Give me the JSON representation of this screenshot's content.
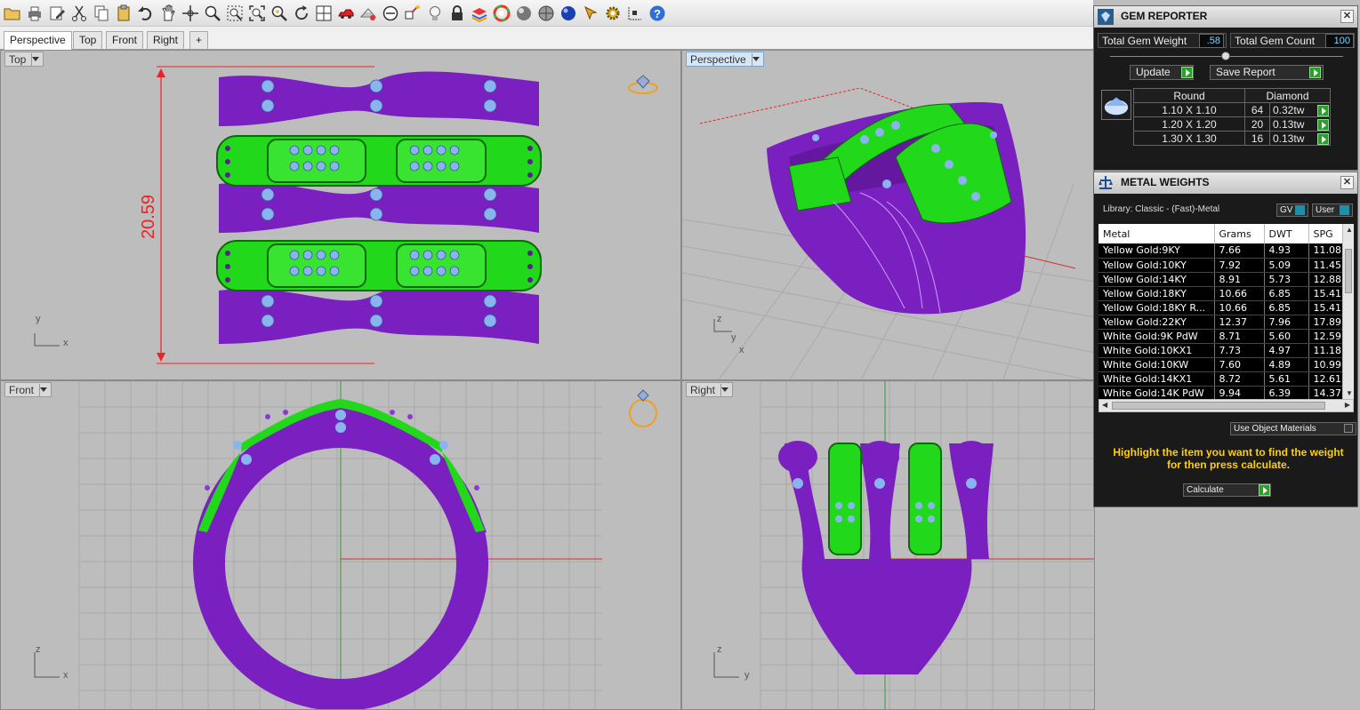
{
  "toolbar": {
    "icons": [
      "folder-icon",
      "print-icon",
      "edit-icon",
      "cut-icon",
      "copy-icon",
      "paste-icon",
      "undo-icon",
      "pan-icon",
      "move-icon",
      "zoom-icon",
      "zoom-window-icon",
      "zoom-extents-icon",
      "zoom-selected-icon",
      "rotate-icon",
      "viewport-layout-icon",
      "car-icon",
      "grid-icon",
      "circle-minus-icon",
      "object-snap-icon",
      "light-bulb-icon",
      "lock-icon",
      "layers-icon",
      "color-wheel-icon",
      "shaded-sphere-icon",
      "rendered-sphere-icon",
      "blue-sphere-icon",
      "pointer-icon",
      "gear-icon",
      "dimension-icon",
      "help-icon"
    ]
  },
  "view_tabs": [
    {
      "label": "Perspective",
      "active": true
    },
    {
      "label": "Top"
    },
    {
      "label": "Front"
    },
    {
      "label": "Right"
    },
    {
      "label": "+"
    }
  ],
  "viewports": {
    "top": {
      "label": "Top",
      "dimension": "20.59",
      "axis_y": "y",
      "axis_x": "x"
    },
    "perspective": {
      "label": "Perspective",
      "axis_z": "z",
      "axis_y": "y",
      "axis_x": "x"
    },
    "front": {
      "label": "Front",
      "axis_z": "z",
      "axis_x": "x"
    },
    "right": {
      "label": "Right",
      "axis_z": "z",
      "axis_y": "y"
    }
  },
  "gem_reporter": {
    "title": "GEM REPORTER",
    "total_weight_label": "Total Gem Weight",
    "total_weight_value": ".58",
    "total_count_label": "Total Gem Count",
    "total_count_value": "100",
    "update_label": "Update",
    "save_label": "Save Report",
    "table_headers": [
      "Round",
      "Diamond"
    ],
    "rows": [
      {
        "size": "1.10 X 1.10",
        "count": "64",
        "weight": "0.32tw"
      },
      {
        "size": "1.20 X 1.20",
        "count": "20",
        "weight": "0.13tw"
      },
      {
        "size": "1.30 X 1.30",
        "count": "16",
        "weight": "0.13tw"
      }
    ]
  },
  "metal_weights": {
    "title": "METAL WEIGHTS",
    "library": "Library: Classic - (Fast)-Metal",
    "gv_label": "GV",
    "user_label": "User",
    "headers": [
      "Metal",
      "Grams",
      "DWT",
      "SPG"
    ],
    "rows": [
      [
        "Yellow Gold:9KY",
        "7.66",
        "4.93",
        "11.08"
      ],
      [
        "Yellow Gold:10KY",
        "7.92",
        "5.09",
        "11.45"
      ],
      [
        "Yellow Gold:14KY",
        "8.91",
        "5.73",
        "12.88"
      ],
      [
        "Yellow Gold:18KY",
        "10.66",
        "6.85",
        "15.41"
      ],
      [
        "Yellow Gold:18KY R...",
        "10.66",
        "6.85",
        "15.41"
      ],
      [
        "Yellow Gold:22KY",
        "12.37",
        "7.96",
        "17.89"
      ],
      [
        "White Gold:9K PdW",
        "8.71",
        "5.60",
        "12.59"
      ],
      [
        "White Gold:10KX1",
        "7.73",
        "4.97",
        "11.18"
      ],
      [
        "White Gold:10KW",
        "7.60",
        "4.89",
        "10.99"
      ],
      [
        "White Gold:14KX1",
        "8.72",
        "5.61",
        "12.61"
      ],
      [
        "White Gold:14K PdW",
        "9.94",
        "6.39",
        "14.37"
      ]
    ],
    "use_object_materials_label": "Use Object Materials",
    "hint": "Highlight the item you want to find the weight for then press calculate.",
    "calculate_label": "Calculate"
  },
  "colors": {
    "viewport_bg": "#bdbdbd",
    "ring_purple": "#7a1fc0",
    "prong_green": "#22d81a",
    "gem_blue": "#8ab4f0",
    "hint_yellow": "#ffd000",
    "panel_bg": "#1a1a1a"
  }
}
